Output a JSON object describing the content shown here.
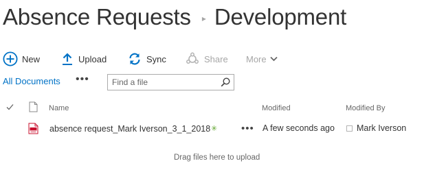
{
  "breadcrumb": {
    "parent": "Absence Requests",
    "current": "Development"
  },
  "toolbar": {
    "new_label": "New",
    "upload_label": "Upload",
    "sync_label": "Sync",
    "share_label": "Share",
    "more_label": "More"
  },
  "viewbar": {
    "view_label": "All Documents",
    "ellipsis": "•••",
    "search_placeholder": "Find a file"
  },
  "columns": {
    "name": "Name",
    "modified": "Modified",
    "modified_by": "Modified By"
  },
  "files": [
    {
      "name": "absence request_Mark Iverson_3_1_2018",
      "new_badge": "✳",
      "ellipsis": "•••",
      "modified": "A few seconds ago",
      "modified_by": "Mark Iverson",
      "type_icon": "pdf-icon"
    }
  ],
  "drag_hint": "Drag files here to upload",
  "colors": {
    "accent": "#0072c6",
    "text": "#333333",
    "muted": "#666666",
    "disabled": "#a6a6a6",
    "new_badge": "#5fa52e",
    "pdf_red": "#c8102e"
  },
  "icons": {
    "new": "plus-circle-icon",
    "upload": "upload-arrow-icon",
    "sync": "sync-icon",
    "share": "share-icon",
    "more": "chevron-down-icon",
    "search": "search-icon",
    "check": "checkmark-icon",
    "doc": "document-icon"
  }
}
